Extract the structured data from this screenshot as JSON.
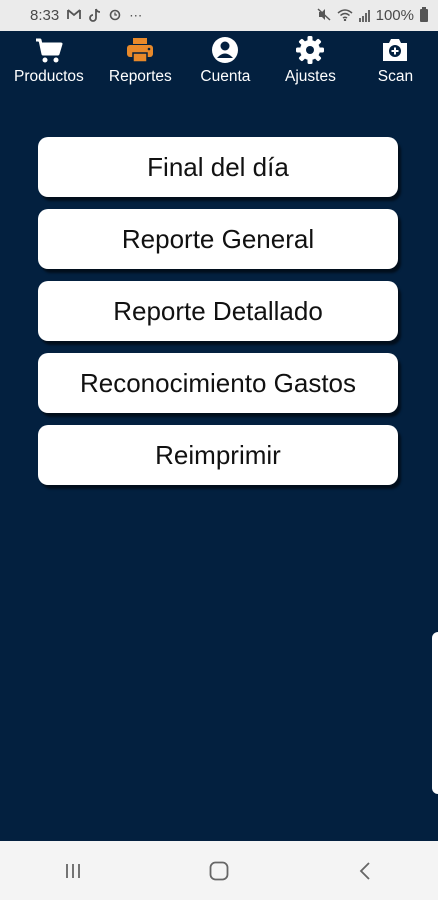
{
  "status_bar": {
    "time": "8:33",
    "battery_text": "100%",
    "left_icons": [
      "gmail-icon",
      "tiktok-icon",
      "clock-icon",
      "more-icon"
    ],
    "right_icons": [
      "mute-icon",
      "wifi-icon",
      "signal-icon",
      "battery-icon"
    ]
  },
  "top_nav": {
    "items": [
      {
        "label": "Productos",
        "icon": "cart-icon",
        "color": "#ffffff"
      },
      {
        "label": "Reportes",
        "icon": "printer-icon",
        "color": "#e8892a",
        "active": true
      },
      {
        "label": "Cuenta",
        "icon": "account-icon",
        "color": "#ffffff"
      },
      {
        "label": "Ajustes",
        "icon": "gear-icon",
        "color": "#ffffff"
      },
      {
        "label": "Scan",
        "icon": "camera-icon",
        "color": "#ffffff"
      }
    ]
  },
  "menu": {
    "buttons": [
      {
        "label": "Final del día"
      },
      {
        "label": "Reporte General"
      },
      {
        "label": "Reporte Detallado"
      },
      {
        "label": "Reconocimiento Gastos"
      },
      {
        "label": "Reimprimir"
      }
    ]
  },
  "colors": {
    "background": "#03203f",
    "accent": "#e8892a",
    "button_bg": "#ffffff"
  },
  "android_nav": {
    "buttons": [
      "recents-icon",
      "home-icon",
      "back-icon"
    ]
  }
}
